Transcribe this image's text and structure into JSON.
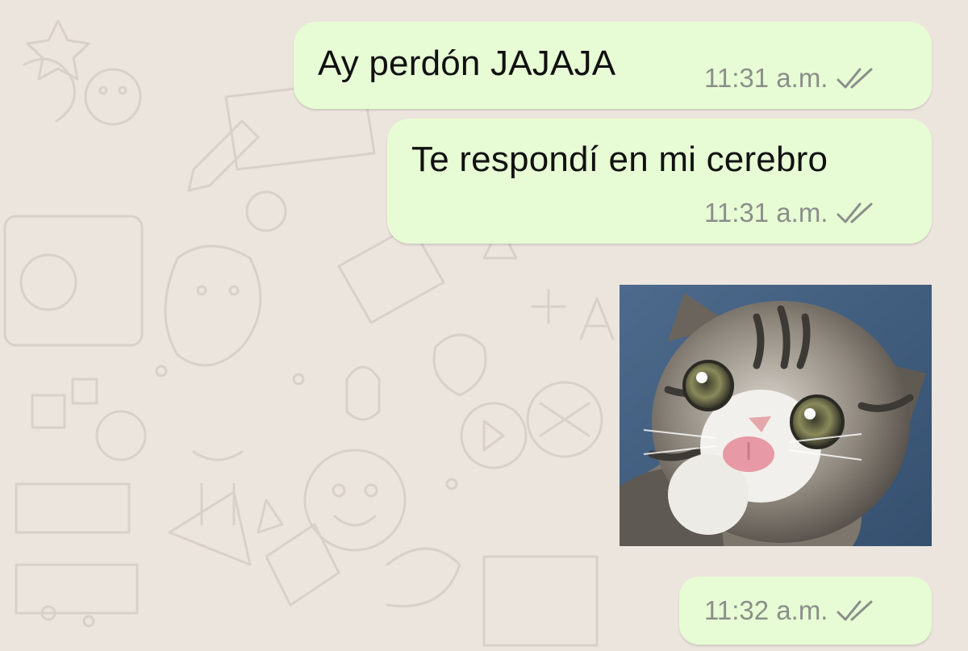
{
  "chat": {
    "background_color": "#ece5dd",
    "outgoing_bubble_color": "#e7fcd4",
    "tick_color": "#8a8f8a",
    "messages": [
      {
        "type": "text",
        "text": "Ay perdón JAJAJA",
        "time": "11:31 a.m.",
        "status_icon": "double-check-icon"
      },
      {
        "type": "text",
        "text": "Te respondí en mi cerebro",
        "time": "11:31 a.m.",
        "status_icon": "double-check-icon"
      },
      {
        "type": "sticker",
        "subject": "kitten-sticker",
        "time": "11:32 a.m.",
        "status_icon": "double-check-icon"
      }
    ]
  }
}
